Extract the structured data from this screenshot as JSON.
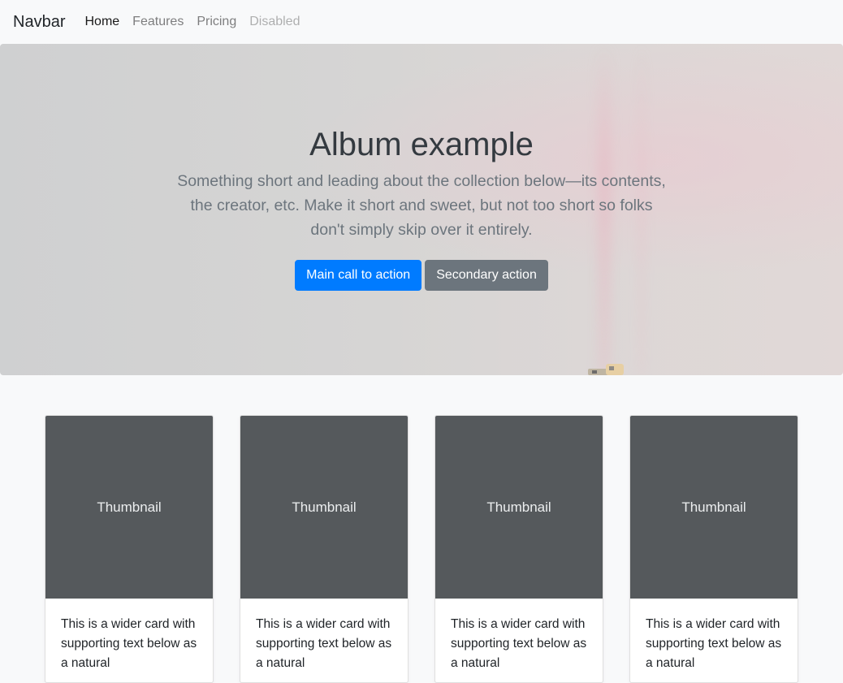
{
  "navbar": {
    "brand": "Navbar",
    "links": [
      {
        "label": "Home",
        "state": "active"
      },
      {
        "label": "Features",
        "state": "normal"
      },
      {
        "label": "Pricing",
        "state": "normal"
      },
      {
        "label": "Disabled",
        "state": "disabled"
      }
    ]
  },
  "hero": {
    "title": "Album example",
    "lead": "Something short and leading about the collection below—its contents, the creator, etc. Make it short and sweet, but not too short so folks don't simply skip over it entirely.",
    "primary_button": "Main call to action",
    "secondary_button": "Secondary action"
  },
  "cards": [
    {
      "thumb_label": "Thumbnail",
      "text": "This is a wider card with supporting text below as a natural"
    },
    {
      "thumb_label": "Thumbnail",
      "text": "This is a wider card with supporting text below as a natural"
    },
    {
      "thumb_label": "Thumbnail",
      "text": "This is a wider card with supporting text below as a natural"
    },
    {
      "thumb_label": "Thumbnail",
      "text": "This is a wider card with supporting text below as a natural"
    }
  ],
  "colors": {
    "primary": "#007bff",
    "secondary": "#6c757d",
    "thumbnail_bg": "#55595c",
    "page_bg": "#f8f9fa"
  }
}
